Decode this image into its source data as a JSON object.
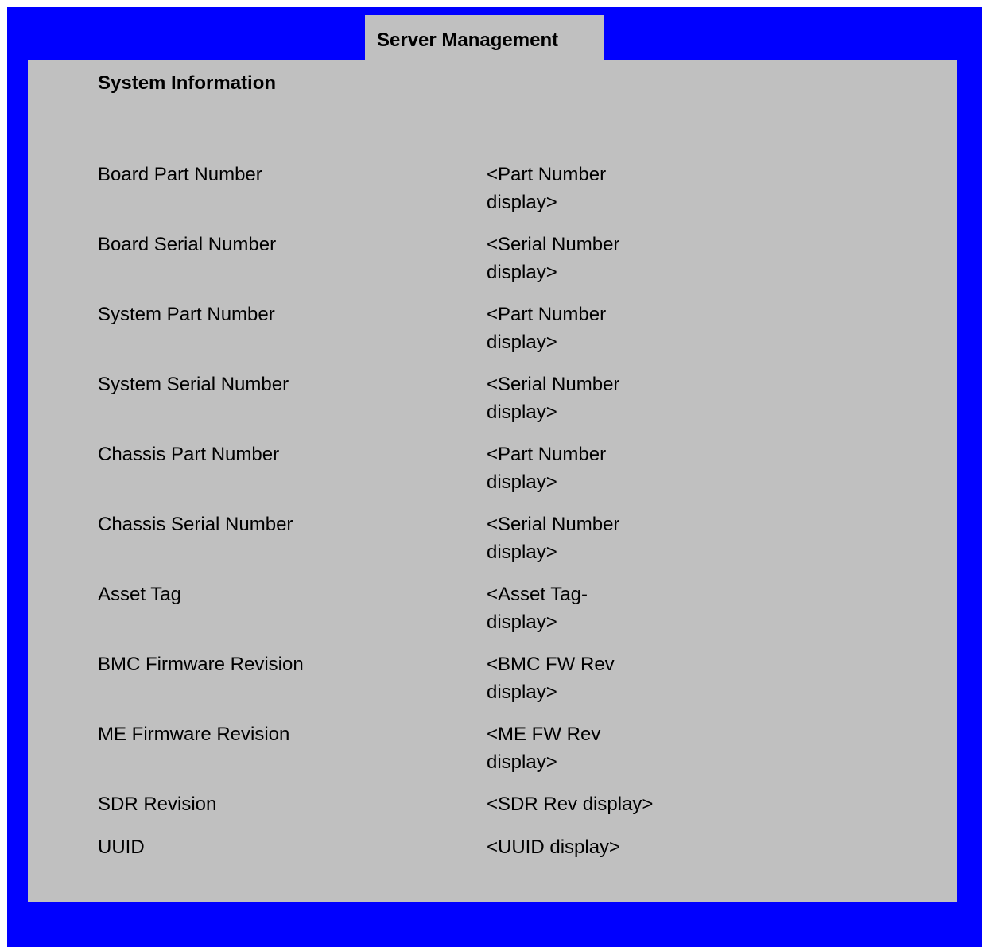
{
  "tab": {
    "label": "Server Management"
  },
  "page": {
    "section_title": "System Information"
  },
  "fields": [
    {
      "label": "Board Part Number",
      "value": "<Part Number display>"
    },
    {
      "label": "Board Serial Number",
      "value": "<Serial Number display>"
    },
    {
      "label": "System Part Number",
      "value": "<Part Number display>"
    },
    {
      "label": "System Serial Number",
      "value": "<Serial Number display>"
    },
    {
      "label": "Chassis Part Number",
      "value": "<Part Number display>"
    },
    {
      "label": "Chassis Serial Number",
      "value": "<Serial Number display>"
    },
    {
      "label": "Asset Tag",
      "value": "<Asset Tag- display>"
    },
    {
      "label": "BMC Firmware Revision",
      "value": "<BMC FW Rev display>"
    },
    {
      "label": "ME Firmware Revision",
      "value": "<ME FW Rev display>"
    },
    {
      "label": "SDR Revision",
      "value": "<SDR Rev display>"
    },
    {
      "label": "UUID",
      "value": "<UUID display>"
    }
  ],
  "colors": {
    "frame": "#0000ff",
    "panel": "#c0c0c0",
    "text": "#000000"
  }
}
